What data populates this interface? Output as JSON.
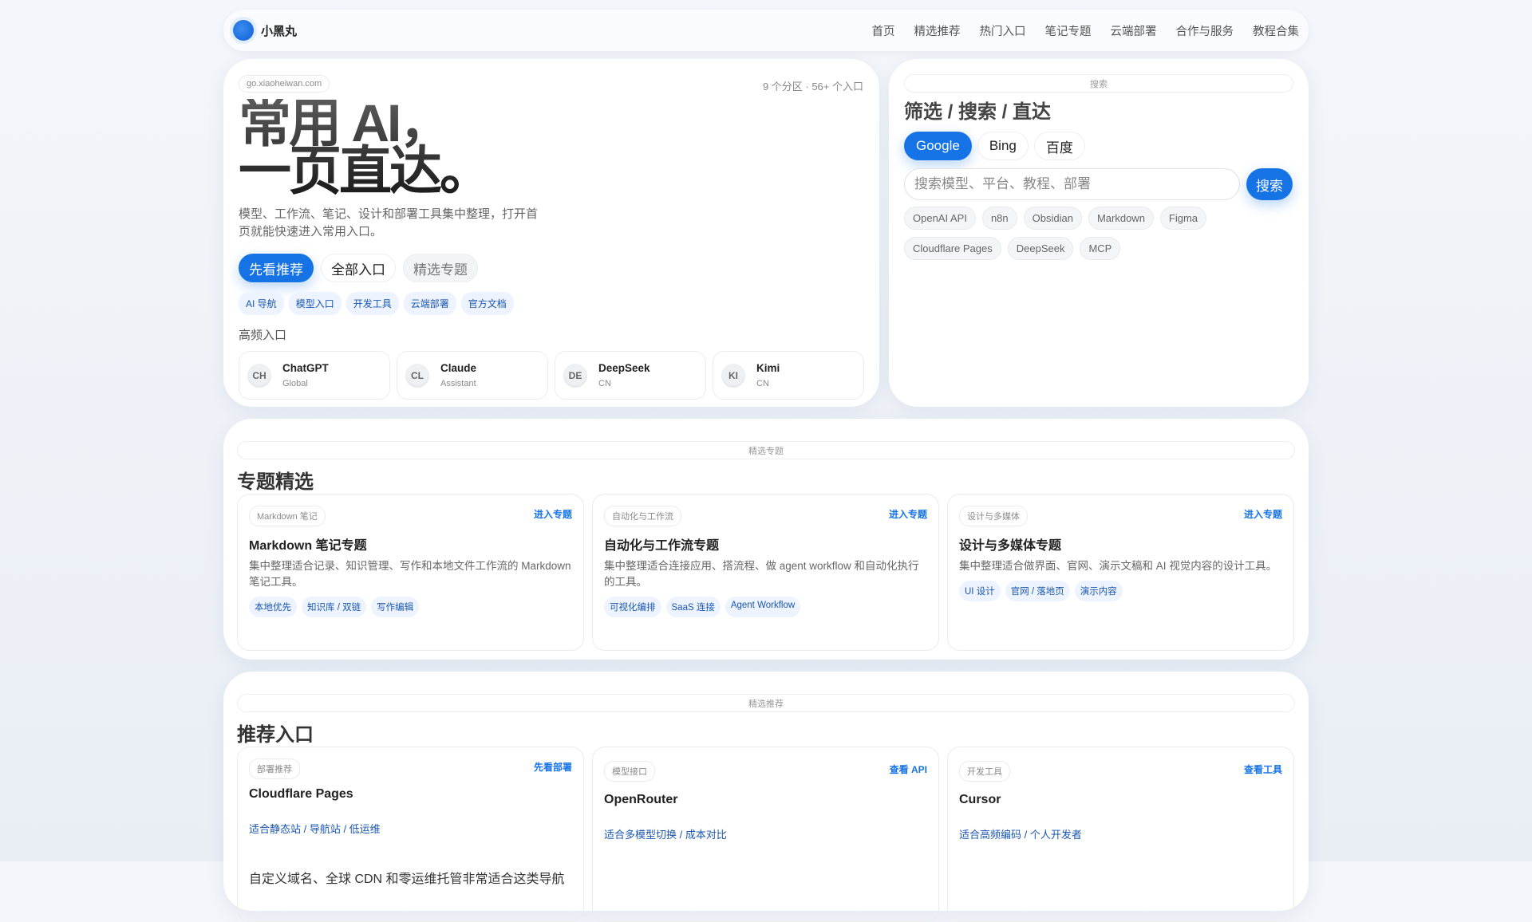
{
  "nav": {
    "brand": "小黑丸",
    "links": [
      "首页",
      "精选推荐",
      "热门入口",
      "笔记专题",
      "云端部署",
      "合作与服务",
      "教程合集"
    ]
  },
  "hero": {
    "domain": "go.xiaoheiwan.com",
    "meta": "9 个分区 · 56+ 个入口",
    "title_line1": "常用 AI，",
    "title_line2": "一页直达。",
    "desc": "模型、工作流、笔记、设计和部署工具集中整理，打开首页就能快速进入常用入口。",
    "buttons": [
      "先看推荐",
      "全部入口",
      "精选专题"
    ],
    "tags": [
      "AI 导航",
      "模型入口",
      "开发工具",
      "云端部署",
      "官方文档"
    ],
    "quick_label": "高频入口",
    "quick": [
      {
        "abbr": "CH",
        "name": "ChatGPT",
        "sub": "Global"
      },
      {
        "abbr": "CL",
        "name": "Claude",
        "sub": "Assistant"
      },
      {
        "abbr": "DE",
        "name": "DeepSeek",
        "sub": "CN"
      },
      {
        "abbr": "KI",
        "name": "Kimi",
        "sub": "CN"
      }
    ]
  },
  "search": {
    "label": "搜索",
    "title": "筛选 / 搜索 / 直达",
    "engines": [
      "Google",
      "Bing",
      "百度"
    ],
    "placeholder": "搜索模型、平台、教程、部署",
    "button": "搜索",
    "chips": [
      "OpenAI API",
      "n8n",
      "Obsidian",
      "Markdown",
      "Figma",
      "Cloudflare Pages",
      "DeepSeek",
      "MCP"
    ]
  },
  "topics": {
    "label": "精选专题",
    "title": "专题精选",
    "cards": [
      {
        "pill": "Markdown 笔记",
        "link": "进入专题",
        "title": "Markdown 笔记专题",
        "desc": "集中整理适合记录、知识管理、写作和本地文件工作流的 Markdown 笔记工具。",
        "tags": [
          "本地优先",
          "知识库 / 双链",
          "写作编辑"
        ]
      },
      {
        "pill": "自动化与工作流",
        "link": "进入专题",
        "title": "自动化与工作流专题",
        "desc": "集中整理适合连接应用、搭流程、做 agent workflow 和自动化执行的工具。",
        "tags": [
          "可视化编排",
          "SaaS 连接",
          "Agent Workflow"
        ]
      },
      {
        "pill": "设计与多媒体",
        "link": "进入专题",
        "title": "设计与多媒体专题",
        "desc": "集中整理适合做界面、官网、演示文稿和 AI 视觉内容的设计工具。",
        "tags": [
          "UI 设计",
          "官网 / 落地页",
          "演示内容"
        ]
      }
    ]
  },
  "recs": {
    "label": "精选推荐",
    "title": "推荐入口",
    "cards": [
      {
        "pill": "部署推荐",
        "link": "先看部署",
        "title": "Cloudflare Pages",
        "fit": "适合静态站 / 导航站 / 低运维",
        "desc": "自定义域名、全球 CDN 和零运维托管非常适合这类导航"
      },
      {
        "pill": "模型接口",
        "link": "查看 API",
        "title": "OpenRouter",
        "fit": "适合多模型切换 / 成本对比"
      },
      {
        "pill": "开发工具",
        "link": "查看工具",
        "title": "Cursor",
        "fit": "适合高频编码 / 个人开发者"
      }
    ]
  }
}
